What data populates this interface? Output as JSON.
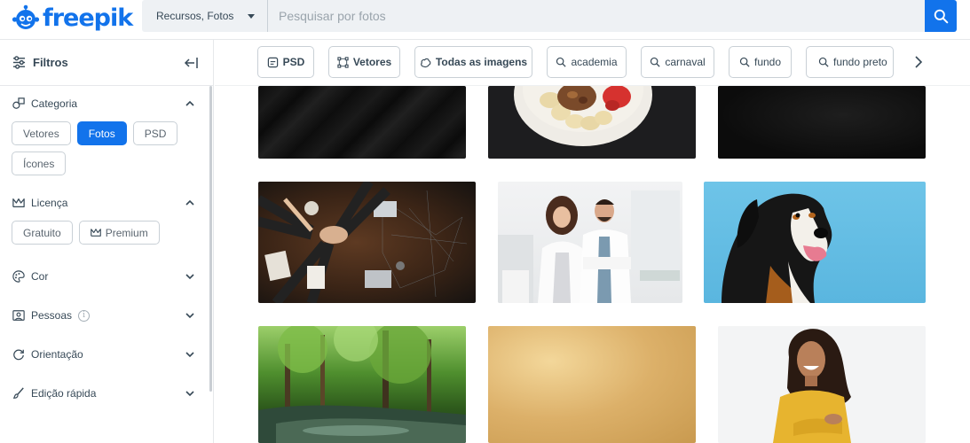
{
  "header": {
    "logo_text": "freepik",
    "search_type": "Recursos, Fotos",
    "search_placeholder": "Pesquisar por fotos"
  },
  "sidebar": {
    "title": "Filtros",
    "sections": [
      {
        "label": "Categoria",
        "expanded": true,
        "chips": [
          "Vetores",
          "Fotos",
          "PSD",
          "Ícones"
        ],
        "active_chip": "Fotos"
      },
      {
        "label": "Licença",
        "expanded": true,
        "chips": [
          "Gratuito",
          "Premium"
        ]
      },
      {
        "label": "Cor",
        "expanded": false
      },
      {
        "label": "Pessoas",
        "expanded": false,
        "info": "i"
      },
      {
        "label": "Orientação",
        "expanded": false
      },
      {
        "label": "Edição rápida",
        "expanded": false
      }
    ]
  },
  "filterbar": {
    "chips": [
      "PSD",
      "Vetores",
      "Todas as imagens",
      "academia",
      "carnaval",
      "fundo",
      "fundo preto"
    ]
  },
  "gallery": {
    "images": [
      "black-diagonal-texture",
      "acai-bowl-with-fruits",
      "dark-black-texture",
      "business-team-hands-on-table",
      "doctors-smiling-in-clinic",
      "bernese-mountain-dog-on-blue",
      "forest-river",
      "gold-glitter-texture",
      "smiling-woman-yellow-sweater"
    ]
  },
  "colors": {
    "accent": "#1273eb",
    "text": "#374957",
    "border": "#c9d0d6"
  }
}
